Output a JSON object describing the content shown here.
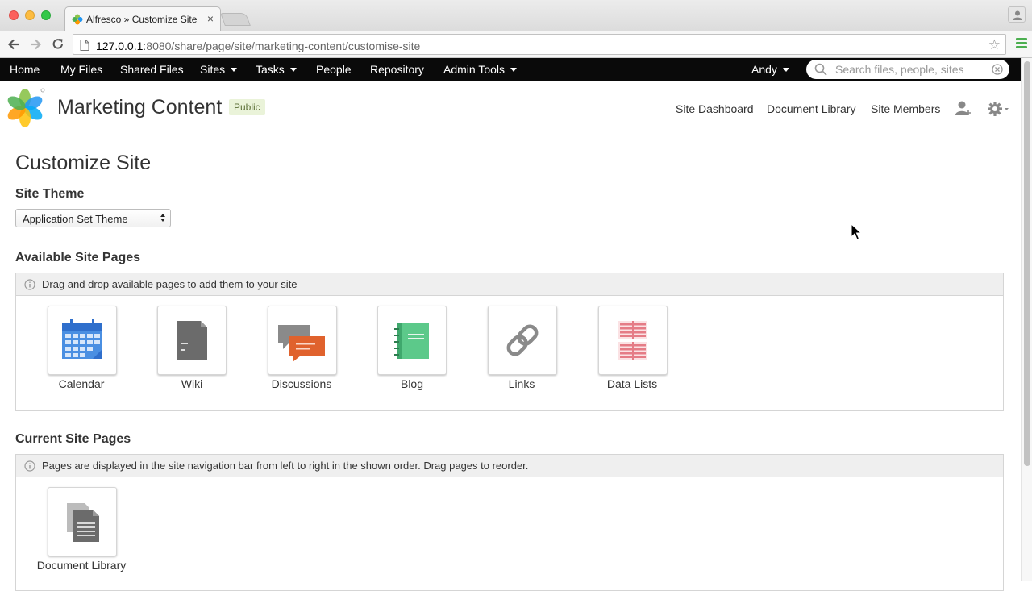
{
  "browser": {
    "tab_title": "Alfresco » Customize Site",
    "url_host": "127.0.0.1",
    "url_rest": ":8080/share/page/site/marketing-content/customise-site"
  },
  "appbar": {
    "items": [
      {
        "label": "Home",
        "dropdown": false
      },
      {
        "label": "My Files",
        "dropdown": false
      },
      {
        "label": "Shared Files",
        "dropdown": false
      },
      {
        "label": "Sites",
        "dropdown": true
      },
      {
        "label": "Tasks",
        "dropdown": true
      },
      {
        "label": "People",
        "dropdown": false
      },
      {
        "label": "Repository",
        "dropdown": false
      },
      {
        "label": "Admin Tools",
        "dropdown": true
      }
    ],
    "user": "Andy",
    "search_placeholder": "Search files, people, sites"
  },
  "site": {
    "title": "Marketing Content",
    "visibility": "Public",
    "nav": [
      "Site Dashboard",
      "Document Library",
      "Site Members"
    ]
  },
  "main": {
    "page_title": "Customize Site",
    "theme_heading": "Site Theme",
    "theme_value": "Application Set Theme",
    "available_heading": "Available Site Pages",
    "available_info": "Drag and drop available pages to add them to your site",
    "available_pages": [
      {
        "label": "Calendar",
        "icon": "calendar-icon"
      },
      {
        "label": "Wiki",
        "icon": "wiki-icon"
      },
      {
        "label": "Discussions",
        "icon": "discussions-icon"
      },
      {
        "label": "Blog",
        "icon": "blog-icon"
      },
      {
        "label": "Links",
        "icon": "links-icon"
      },
      {
        "label": "Data Lists",
        "icon": "data-lists-icon"
      }
    ],
    "current_heading": "Current Site Pages",
    "current_info": "Pages are displayed in the site navigation bar from left to right in the shown order. Drag pages to reorder.",
    "current_pages": [
      {
        "label": "Document Library",
        "icon": "document-library-icon"
      }
    ]
  },
  "colors": {
    "appbar_bg": "#0a0a0a",
    "public_badge_bg": "#eaf3d9",
    "calendar_blue": "#4a8fe2",
    "discussions_orange": "#e0622d",
    "blog_green": "#5cc98a",
    "datalists_red": "#f0a7ad"
  }
}
